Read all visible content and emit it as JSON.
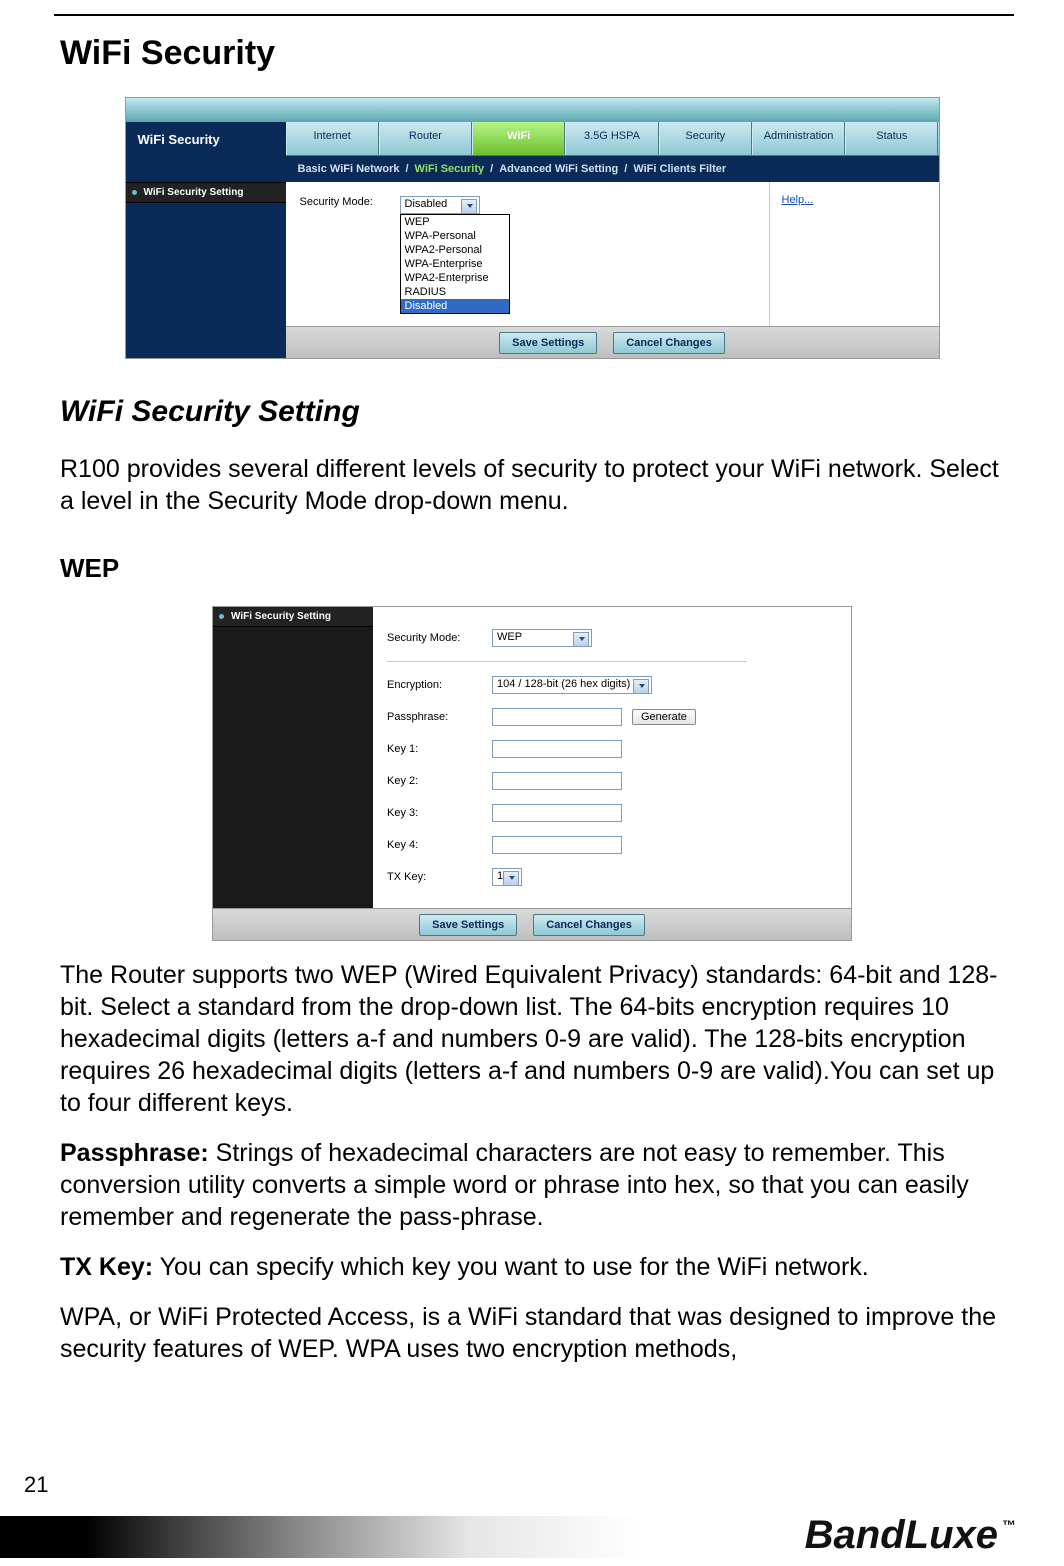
{
  "page": {
    "number": "21",
    "brand": "BandLuxe",
    "tm": "™"
  },
  "headings": {
    "h1": "WiFi Security",
    "h2": "WiFi Security Setting",
    "h3": "WEP"
  },
  "text": {
    "intro": "R100 provides several different levels of security to protect your WiFi network. Select a level in the Security Mode drop-down menu.",
    "wep_desc": "The Router supports two WEP (Wired Equivalent Privacy) standards: 64-bit and 128-bit. Select a standard from the drop-down list. The 64-bits encryption requires 10 hexadecimal digits (letters a-f and numbers 0-9 are valid). The 128-bits encryption requires 26 hexadecimal digits (letters a-f and numbers 0-9 are valid).You can set up to four different keys.",
    "passphrase_label": "Passphrase:",
    "passphrase_text": " Strings of hexadecimal characters are not easy to remember. This conversion utility converts a simple word or phrase into hex, so that you can easily remember and regenerate the pass-phrase.",
    "txkey_label": "TX Key:",
    "txkey_text": " You can specify which key you want to use for the WiFi network.",
    "wpa_text": "WPA, or WiFi Protected Access, is a WiFi standard that was designed to improve the security features of WEP. WPA uses two encryption methods,"
  },
  "screenshot1": {
    "left_header": "WiFi Security",
    "left_item": "WiFi Security Setting",
    "tabs": [
      "Internet",
      "Router",
      "WiFi",
      "3.5G HSPA",
      "Security",
      "Administration",
      "Status"
    ],
    "active_tab_index": 2,
    "subtabs": [
      "Basic WiFi Network",
      "WiFi Security",
      "Advanced WiFi Setting",
      "WiFi Clients Filter"
    ],
    "active_subtab_index": 1,
    "security_mode_label": "Security Mode:",
    "security_mode_value": "Disabled",
    "dropdown_options": [
      "WEP",
      "WPA-Personal",
      "WPA2-Personal",
      "WPA-Enterprise",
      "WPA2-Enterprise",
      "RADIUS",
      "Disabled"
    ],
    "dropdown_selected_index": 6,
    "help_link": "Help...",
    "save_btn": "Save Settings",
    "cancel_btn": "Cancel Changes"
  },
  "screenshot2": {
    "left_item": "WiFi Security Setting",
    "labels": {
      "security_mode": "Security Mode:",
      "encryption": "Encryption:",
      "passphrase": "Passphrase:",
      "key1": "Key 1:",
      "key2": "Key 2:",
      "key3": "Key 3:",
      "key4": "Key 4:",
      "txkey": "TX Key:"
    },
    "security_mode_value": "WEP",
    "encryption_value": "104 / 128-bit (26 hex digits)",
    "generate_btn": "Generate",
    "txkey_value": "1",
    "save_btn": "Save Settings",
    "cancel_btn": "Cancel Changes"
  }
}
